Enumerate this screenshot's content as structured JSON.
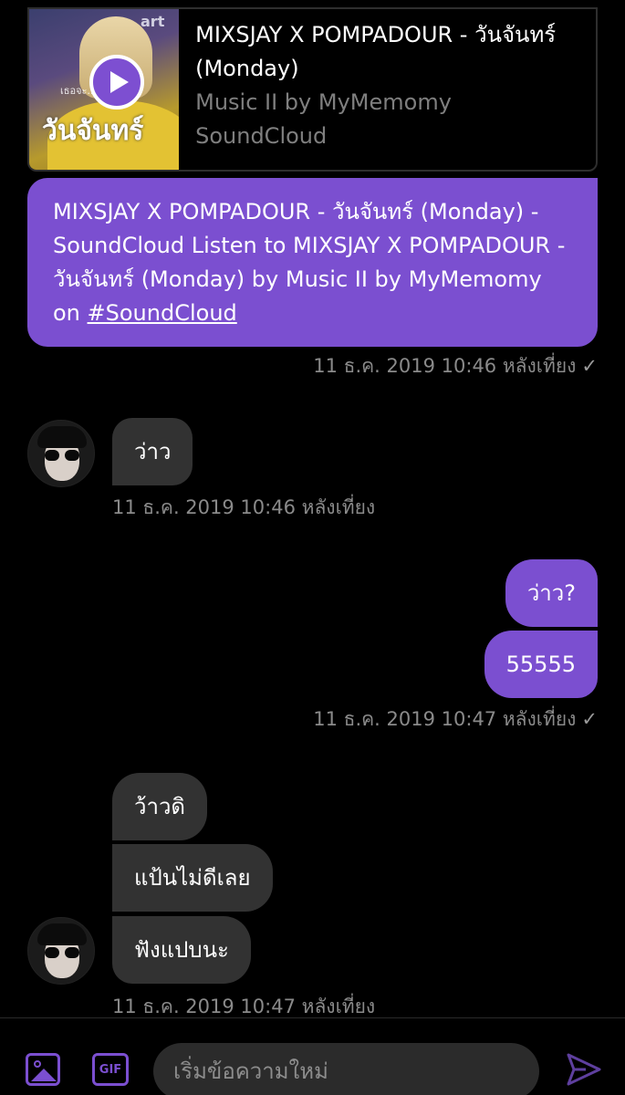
{
  "preview_card": {
    "title": "MIXSJAY X POMPADOUR - วันจันทร์ (Monday)",
    "subtitle": "Music II by MyMemomy",
    "source": "SoundCloud",
    "thumb_watermark": "art",
    "thumb_small_text": "เธอจะ...ปลา?",
    "thumb_title": "วันจันทร์"
  },
  "messages": {
    "shared_link": {
      "text": "MIXSJAY X POMPADOUR - วันจันทร์ (Monday) - SoundCloud Listen to MIXSJAY X POMPADOUR - วันจันทร์ (Monday) by Music II by MyMemomy on ",
      "hashtag": "#SoundCloud"
    },
    "shared_link_time": "11 ธ.ค. 2019 10:46 หลังเที่ยง",
    "in_1": "ว่าว",
    "in_1_time": "11 ธ.ค. 2019 10:46 หลังเที่ยง",
    "out_1": "ว่าว?",
    "out_2": "55555",
    "out_time": "11 ธ.ค. 2019 10:47 หลังเที่ยง",
    "in_2": "ว้าวดิ",
    "in_3": "แป้นไม่ดีเลย",
    "in_4": "ฟังแปบนะ",
    "in_group_time": "11 ธ.ค. 2019 10:47 หลังเที่ยง",
    "read_mark": "✓"
  },
  "composer": {
    "placeholder": "เริ่มข้อความใหม่",
    "gif_label": "GIF"
  },
  "colors": {
    "accent": "#7b4fd0",
    "incoming_bubble": "#323232",
    "background": "#000000"
  },
  "icons": [
    "play-icon",
    "image-icon",
    "gif-icon",
    "send-icon",
    "check-icon"
  ]
}
